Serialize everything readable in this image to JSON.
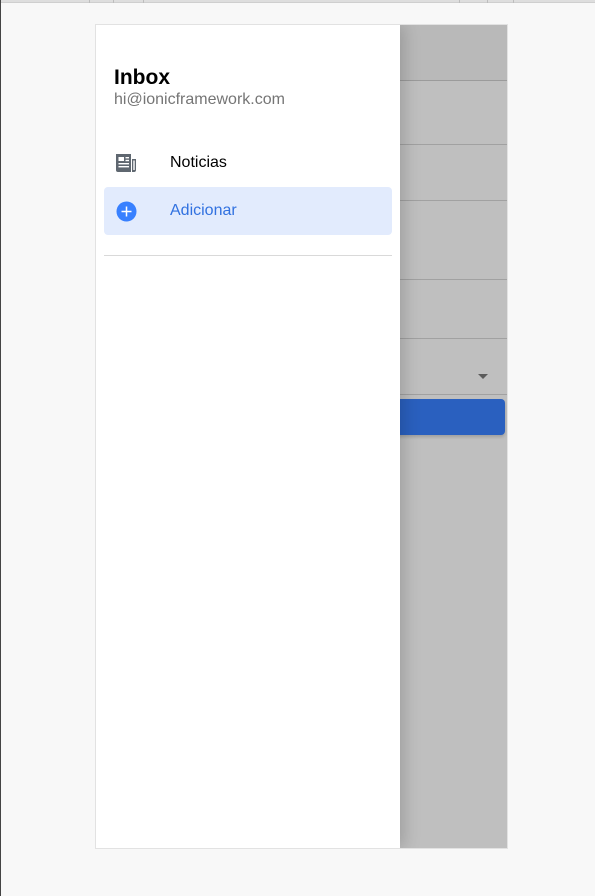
{
  "menu": {
    "title": "Inbox",
    "note": "hi@ionicframework.com",
    "items": [
      {
        "label": "Noticias",
        "icon": "newspaper-icon",
        "selected": false
      },
      {
        "label": "Adicionar",
        "icon": "add-circle-icon",
        "selected": true
      }
    ]
  },
  "colors": {
    "primary": "#3880ff",
    "selected_background": "#e2ebfd",
    "selected_text": "#3171e0",
    "icon_gray": "#5f6770"
  }
}
